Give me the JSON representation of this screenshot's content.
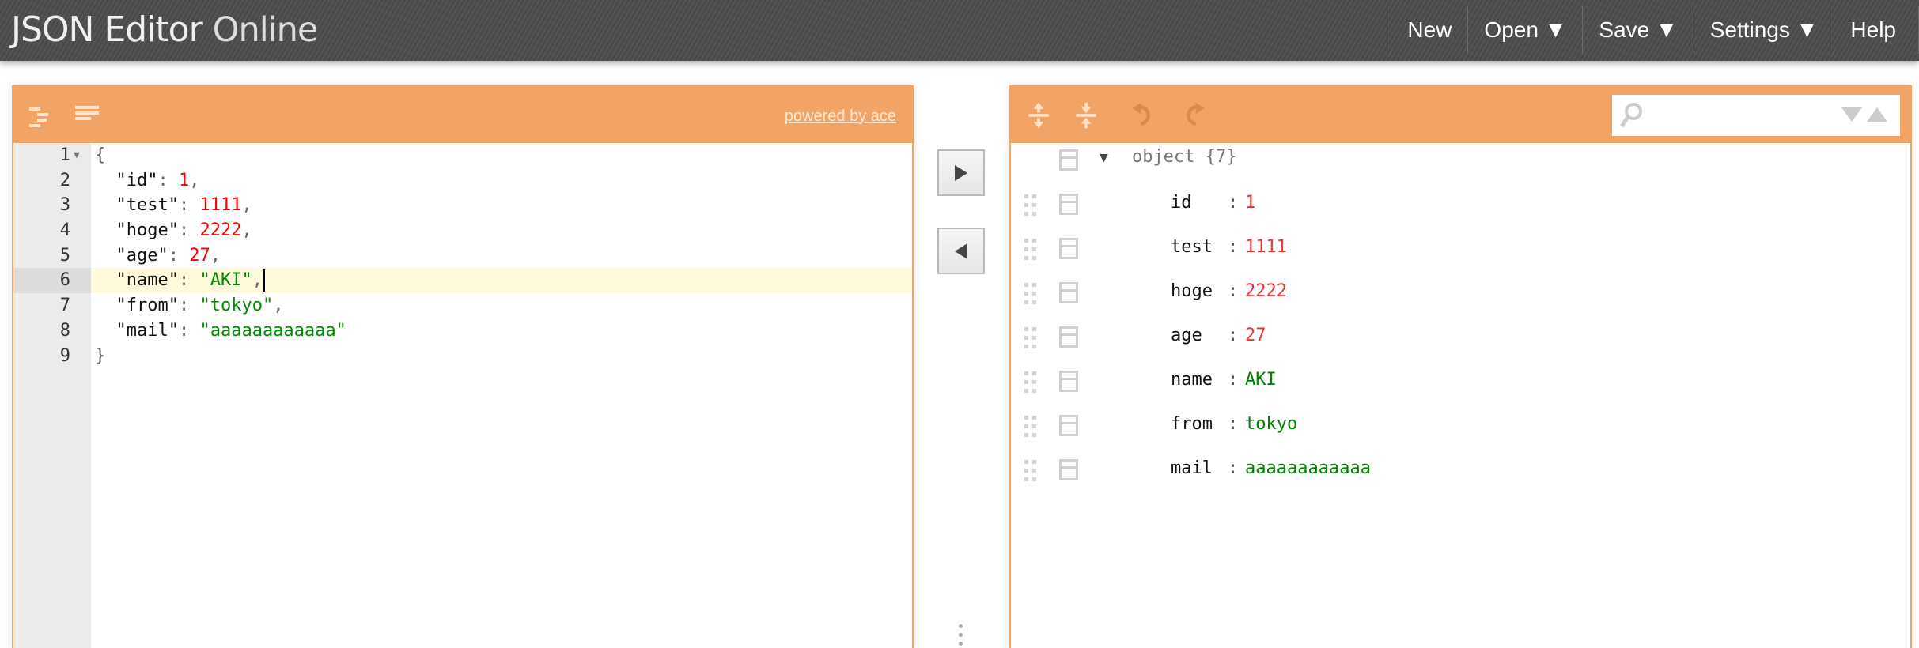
{
  "header": {
    "title_bold": "JSON Editor",
    "title_light": "Online",
    "menu": [
      {
        "label": "New"
      },
      {
        "label": "Open ▼"
      },
      {
        "label": "Save ▼"
      },
      {
        "label": "Settings ▼"
      },
      {
        "label": "Help"
      }
    ]
  },
  "code_editor": {
    "powered_by": "powered by ace",
    "active_line": 6,
    "lines": [
      {
        "n": "1",
        "parts": [
          [
            "p",
            "{"
          ]
        ]
      },
      {
        "n": "2",
        "parts": [
          [
            "k",
            "  \"id\""
          ],
          [
            "p",
            ": "
          ],
          [
            "n",
            "1"
          ],
          [
            "p",
            ","
          ]
        ]
      },
      {
        "n": "3",
        "parts": [
          [
            "k",
            "  \"test\""
          ],
          [
            "p",
            ": "
          ],
          [
            "n",
            "1111"
          ],
          [
            "p",
            ","
          ]
        ]
      },
      {
        "n": "4",
        "parts": [
          [
            "k",
            "  \"hoge\""
          ],
          [
            "p",
            ": "
          ],
          [
            "n",
            "2222"
          ],
          [
            "p",
            ","
          ]
        ]
      },
      {
        "n": "5",
        "parts": [
          [
            "k",
            "  \"age\""
          ],
          [
            "p",
            ": "
          ],
          [
            "n",
            "27"
          ],
          [
            "p",
            ","
          ]
        ]
      },
      {
        "n": "6",
        "parts": [
          [
            "k",
            "  \"name\""
          ],
          [
            "p",
            ": "
          ],
          [
            "s",
            "\"AKI\""
          ],
          [
            "p",
            ","
          ]
        ]
      },
      {
        "n": "7",
        "parts": [
          [
            "k",
            "  \"from\""
          ],
          [
            "p",
            ": "
          ],
          [
            "s",
            "\"tokyo\""
          ],
          [
            "p",
            ","
          ]
        ]
      },
      {
        "n": "8",
        "parts": [
          [
            "k",
            "  \"mail\""
          ],
          [
            "p",
            ": "
          ],
          [
            "s",
            "\"aaaaaaaaaaaa\""
          ]
        ]
      },
      {
        "n": "9",
        "parts": [
          [
            "p",
            "}"
          ]
        ]
      }
    ]
  },
  "tree_editor": {
    "search": {
      "value": "",
      "placeholder": ""
    },
    "root": {
      "label": "object {7}"
    },
    "fields": [
      {
        "key": "id",
        "value": "1",
        "type": "number"
      },
      {
        "key": "test",
        "value": "1111",
        "type": "number"
      },
      {
        "key": "hoge",
        "value": "2222",
        "type": "number"
      },
      {
        "key": "age",
        "value": "27",
        "type": "number"
      },
      {
        "key": "name",
        "value": "AKI",
        "type": "string"
      },
      {
        "key": "from",
        "value": "tokyo",
        "type": "string"
      },
      {
        "key": "mail",
        "value": "aaaaaaaaaaaa",
        "type": "string"
      }
    ]
  },
  "colors": {
    "accent": "#f1a466",
    "number": "#ee3333",
    "string": "#008000"
  }
}
